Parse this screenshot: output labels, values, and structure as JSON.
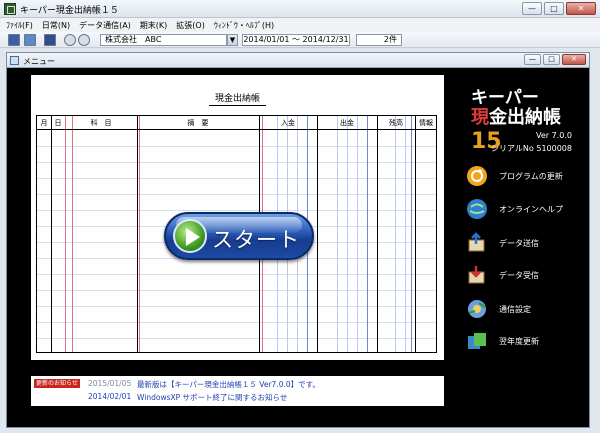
{
  "window": {
    "title": "キーパー現金出納帳１５",
    "btn_min": "—",
    "btn_max": "□",
    "btn_close": "✕"
  },
  "menu": [
    "ﾌｧｲﾙ(F)",
    "日常(N)",
    "データ通信(A)",
    "期末(K)",
    "拡張(O)",
    "ｳｨﾝﾄﾞｳ・ﾍﾙﾌﾟ(H)"
  ],
  "toolbar": {
    "company": "株式会社　ABC",
    "dropdown": "▼",
    "period": "2014/01/01 〜 2014/12/31",
    "count": "2件"
  },
  "inner_window": {
    "title": "メニュー",
    "btn_min": "—",
    "btn_max": "□",
    "btn_close": "✕"
  },
  "ledger": {
    "title": "現金出納帳",
    "headers": {
      "month": "月",
      "day": "日",
      "account": "科　目",
      "desc": "摘　要",
      "in": "入金",
      "out": "出金",
      "balance": "残高",
      "info": "情報"
    }
  },
  "start_label": "スタート",
  "brand": {
    "line1": "キーパー",
    "line2_red": "現",
    "line2_white": "金出納帳",
    "line2_num": "15",
    "version": "Ver 7.0.0",
    "serial": "シリアルNo 5100008"
  },
  "side_menu": [
    {
      "label": "プログラムの更新",
      "icon": "update-icon"
    },
    {
      "label": "オンラインヘルプ",
      "icon": "online-help-icon"
    },
    {
      "label": "データ送信",
      "icon": "data-send-icon"
    },
    {
      "label": "データ受信",
      "icon": "data-receive-icon"
    },
    {
      "label": "通信設定",
      "icon": "settings-icon"
    },
    {
      "label": "翌年度更新",
      "icon": "next-year-icon"
    }
  ],
  "news": {
    "badge": "更新のお知らせ",
    "items": [
      {
        "date": "2015/01/05",
        "text": "最新版は【キーパー現金出納帳１５ Ver7.0.0】です。"
      },
      {
        "date": "2014/02/01",
        "text": "WindowsXP サポート終了に関するお知らせ"
      }
    ]
  },
  "colors": {
    "accent_red": "#e23a3a",
    "accent_orange": "#e8a020",
    "news_blue": "#1f3fb0",
    "news_gray": "#7a8aa8"
  }
}
